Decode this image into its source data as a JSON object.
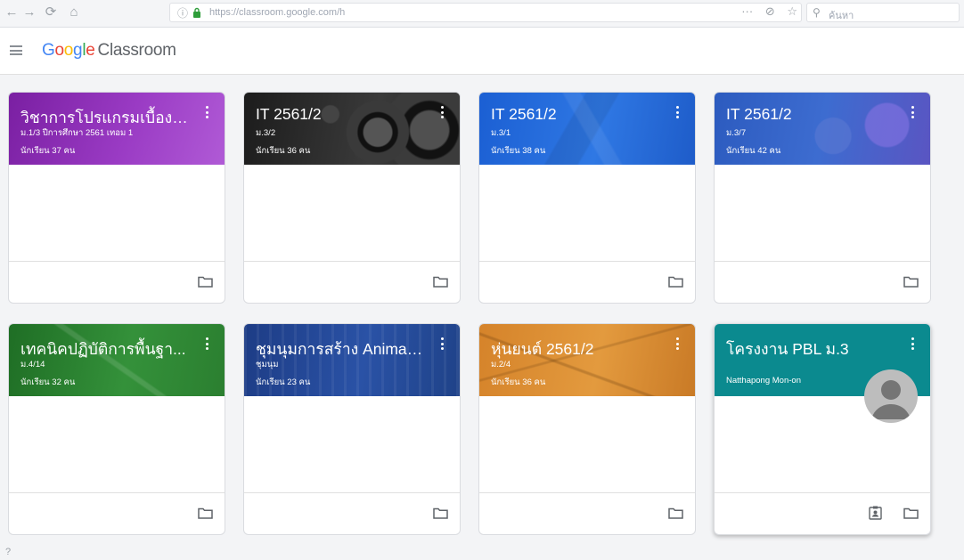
{
  "browser": {
    "nav": {
      "back": "←",
      "forward": "→",
      "reload": "⟳",
      "home": "⌂"
    },
    "url": "https://classroom.google.com/h",
    "actions": {
      "more": "···",
      "pocket": "⊘",
      "bookmark": "☆"
    },
    "search_placeholder": "ค้นหา"
  },
  "header": {
    "logo": {
      "g1": "G",
      "g2": "o",
      "g3": "o",
      "g4": "g",
      "g5": "l",
      "g6": "e",
      "product": "Classroom"
    }
  },
  "classes": [
    {
      "title": "วิชาการโปรแกรมเบื้องต้น",
      "section": "ม.1/3 ปีการศึกษา 2561 เทอม 1",
      "students": "นักเรียน 37 คน",
      "color": "#8e24aa"
    },
    {
      "title": "IT 2561/2",
      "section": "ม.3/2",
      "students": "นักเรียน 36 คน",
      "color": "#2b2b2b"
    },
    {
      "title": "IT 2561/2",
      "section": "ม.3/1",
      "students": "นักเรียน 38 คน",
      "color": "#1e63d6"
    },
    {
      "title": "IT 2561/2",
      "section": "ม.3/7",
      "students": "นักเรียน 42 คน",
      "color": "#2960c8"
    },
    {
      "title": "เทคนิคปฏิบัติการพื้นฐา...",
      "section": "ม.4/14",
      "students": "นักเรียน 32 คน",
      "color": "#2e7d32"
    },
    {
      "title": "ชุมนุมการสร้าง Animati...",
      "section": "ชุมนุม",
      "students": "นักเรียน 23 คน",
      "color": "#23468f"
    },
    {
      "title": "หุ่นยนต์ 2561/2",
      "section": "ม.2/4",
      "students": "นักเรียน 36 คน",
      "color": "#d98a2b"
    },
    {
      "title": "โครงงาน PBL ม.3",
      "owner": "Natthapong Mon-on",
      "color": "#0b8a8f"
    }
  ]
}
